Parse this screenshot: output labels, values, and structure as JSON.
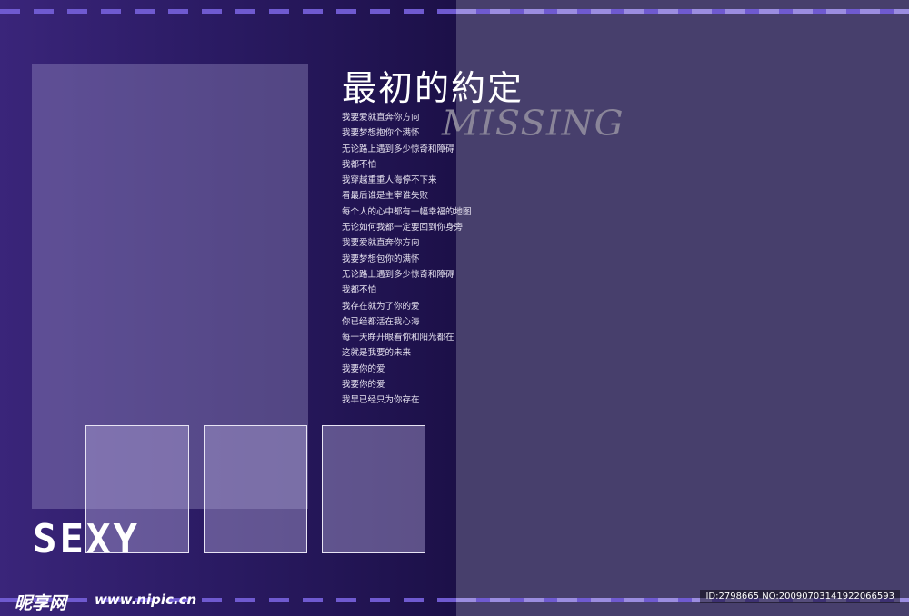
{
  "title": "最初的約定",
  "subtitle_deco": "MISSING",
  "lyrics": [
    "我要爱就直奔你方向",
    "我要梦想抱你个满怀",
    "无论路上遇到多少惊奇和障碍",
    "我都不怕",
    "我穿越重重人海停不下来",
    "看最后谁是主宰谁失败",
    "每个人的心中都有一幅幸福的地图",
    "无论如何我都一定要回到你身旁",
    "我要爱就直奔你方向",
    "我要梦想包你的满怀",
    "无论路上遇到多少惊奇和障碍",
    "我都不怕",
    "我存在就为了你的爱",
    "你已经都活在我心海",
    "每一天睁开眼看你和阳光都在",
    "这就是我要的未来",
    "我要你的爱",
    "我要你的爱",
    "我早已经只为你存在"
  ],
  "decor_text": "SEXY",
  "watermark": {
    "logo": "昵享网",
    "url": "www.nipic.cn",
    "id_line": "ID:2798665 NO:20090703141922066593"
  }
}
